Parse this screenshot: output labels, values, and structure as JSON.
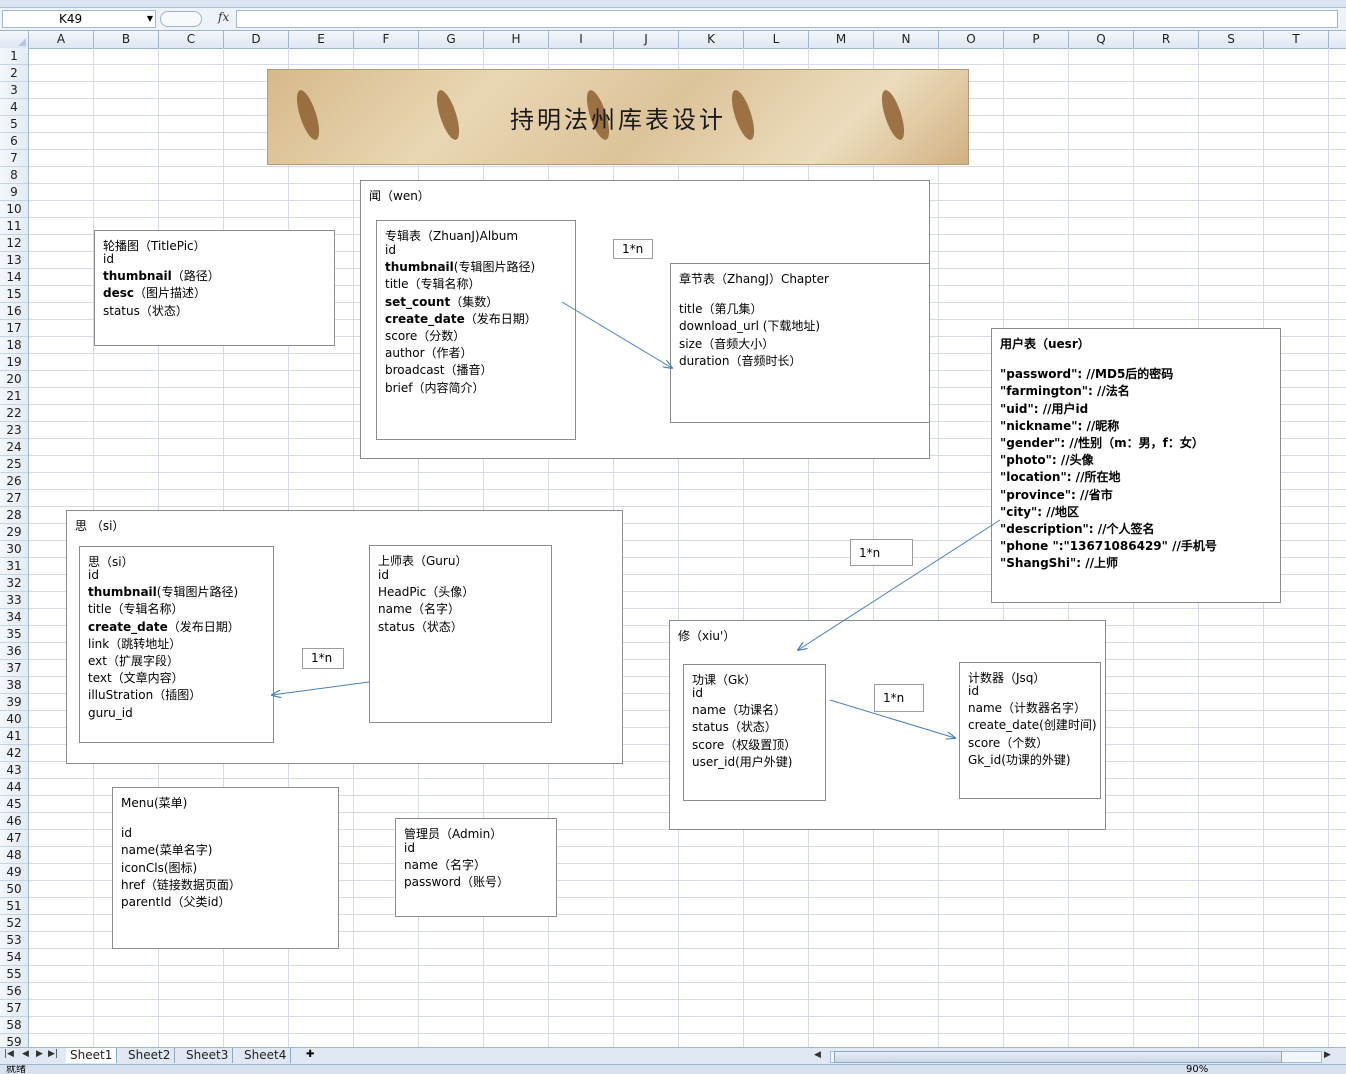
{
  "formula_bar": {
    "name_box": "K49",
    "fx_label": "fx",
    "formula": ""
  },
  "columns": [
    "A",
    "B",
    "C",
    "D",
    "E",
    "F",
    "G",
    "H",
    "I",
    "J",
    "K",
    "L",
    "M",
    "N",
    "O",
    "P",
    "Q",
    "R",
    "S",
    "T"
  ],
  "rows": [
    "1",
    "2",
    "3",
    "4",
    "5",
    "6",
    "7",
    "8",
    "9",
    "10",
    "11",
    "12",
    "13",
    "14",
    "15",
    "16",
    "17",
    "18",
    "19",
    "20",
    "21",
    "22",
    "23",
    "24",
    "25",
    "26",
    "27",
    "28",
    "29",
    "30",
    "31",
    "32",
    "33",
    "34",
    "35",
    "36",
    "37",
    "38",
    "39",
    "40",
    "41",
    "42",
    "43",
    "44",
    "45",
    "46",
    "47",
    "48",
    "49",
    "50",
    "51",
    "52",
    "53",
    "54",
    "55",
    "56",
    "57",
    "58",
    "59"
  ],
  "banner": {
    "title": "持明法州库表设计"
  },
  "groups": {
    "wen": "闻（wen）",
    "si": "思 （si）",
    "xiu": "修（xiu'）"
  },
  "tables": {
    "titlepic": {
      "title": "轮播图（TitlePic）",
      "fields": [
        {
          "text": "id",
          "bold": false
        },
        {
          "text": "thumbnail",
          "bold": true,
          "rest": "（路径）"
        },
        {
          "text": "desc",
          "bold": true,
          "rest": "（图片描述）"
        },
        {
          "text": "status（状态）",
          "bold": false
        }
      ]
    },
    "album": {
      "title": "专辑表（ZhuanJ)Album",
      "fields": [
        {
          "text": "id",
          "bold": false
        },
        {
          "text": "thumbnail",
          "bold": true,
          "rest": "(专辑图片路径)"
        },
        {
          "text": "title（专辑名称）",
          "bold": false
        },
        {
          "text": "set_count",
          "bold": true,
          "rest": "（集数）"
        },
        {
          "text": "create_date",
          "bold": true,
          "rest": "（发布日期）"
        },
        {
          "text": "score（分数）",
          "bold": false
        },
        {
          "text": "author（作者）",
          "bold": false
        },
        {
          "text": "broadcast（播音）",
          "bold": false
        },
        {
          "text": "brief（内容简介）",
          "bold": false
        }
      ]
    },
    "chapter": {
      "title": "章节表（ZhangJ）Chapter",
      "fields": [
        {
          "text": "",
          "bold": false
        },
        {
          "text": "title（第几集）",
          "bold": false
        },
        {
          "text": "download_url (下载地址)",
          "bold": false
        },
        {
          "text": "size（音频大小）",
          "bold": false
        },
        {
          "text": "duration（音频时长）",
          "bold": false
        }
      ]
    },
    "user": {
      "title": "用户表（uesr）",
      "fields": [
        {
          "text": "",
          "bold": true
        },
        {
          "text": "\"password\":    //MD5后的密码",
          "bold": true
        },
        {
          "text": "\"farmington\":  //法名",
          "bold": true
        },
        {
          "text": "\"uid\": //用户id",
          "bold": true
        },
        {
          "text": " \"nickname\":  //昵称",
          "bold": true
        },
        {
          "text": " \"gender\": //性别（m：男，f：女）",
          "bold": true
        },
        {
          "text": "  \"photo\":  //头像",
          "bold": true
        },
        {
          "text": "\"location\":  //所在地",
          "bold": true
        },
        {
          "text": "\"province\":  //省市",
          "bold": true
        },
        {
          "text": "\"city\":   //地区",
          "bold": true
        },
        {
          "text": " \"description\":  //个人签名",
          "bold": true
        },
        {
          "text": " \"phone \":\"13671086429\"     //手机号",
          "bold": true
        },
        {
          "text": "\"ShangShi\": //上师",
          "bold": true
        }
      ]
    },
    "si": {
      "title": "思（si）",
      "fields": [
        {
          "text": "id",
          "bold": false
        },
        {
          "text": "thumbnail",
          "bold": true,
          "rest": "(专辑图片路径)"
        },
        {
          "text": "title（专辑名称）",
          "bold": false
        },
        {
          "text": "create_date",
          "bold": true,
          "rest": "（发布日期）"
        },
        {
          "text": "link（跳转地址）",
          "bold": false
        },
        {
          "text": "ext（扩展字段）",
          "bold": false
        },
        {
          "text": "text（文章内容）",
          "bold": false
        },
        {
          "text": "illuStration（插图）",
          "bold": false
        },
        {
          "text": "guru_id",
          "bold": false
        }
      ]
    },
    "guru": {
      "title": "上师表（Guru）",
      "fields": [
        {
          "text": "id",
          "bold": false
        },
        {
          "text": "HeadPic（头像）",
          "bold": false
        },
        {
          "text": "name（名字）",
          "bold": false
        },
        {
          "text": "status（状态）",
          "bold": false
        }
      ]
    },
    "gk": {
      "title": "功课（Gk）",
      "fields": [
        {
          "text": "id",
          "bold": false
        },
        {
          "text": "name（功课名）",
          "bold": false
        },
        {
          "text": "status（状态）",
          "bold": false
        },
        {
          "text": "score（权级置顶）",
          "bold": false
        },
        {
          "text": "user_id(用户外键)",
          "bold": false
        }
      ]
    },
    "jsq": {
      "title": "计数器（Jsq）",
      "fields": [
        {
          "text": "id",
          "bold": false
        },
        {
          "text": "name（计数器名字）",
          "bold": false
        },
        {
          "text": "create_date(创建时间)",
          "bold": false
        },
        {
          "text": "score（个数）",
          "bold": false
        },
        {
          "text": "Gk_id(功课的外键)",
          "bold": false
        }
      ]
    },
    "menu": {
      "title": "Menu(菜单)",
      "fields": [
        {
          "text": "",
          "bold": false
        },
        {
          "text": "id",
          "bold": false
        },
        {
          "text": "name(菜单名字)",
          "bold": false
        },
        {
          "text": "iconCls(图标)",
          "bold": false
        },
        {
          "text": "href（链接数据页面）",
          "bold": false
        },
        {
          "text": "parentId（父类id）",
          "bold": false
        }
      ]
    },
    "admin": {
      "title": "管理员（Admin）",
      "fields": [
        {
          "text": "id",
          "bold": false
        },
        {
          "text": "name（名字）",
          "bold": false
        },
        {
          "text": "password（账号）",
          "bold": false
        }
      ]
    }
  },
  "relations": {
    "album_chapter": "1*n",
    "user_gk": "1*n",
    "guru_si": "1*n",
    "gk_jsq": "1*n"
  },
  "sheet_tabs": [
    "Sheet1",
    "Sheet2",
    "Sheet3",
    "Sheet4"
  ],
  "status_bar": {
    "ready": "就绪",
    "zoom": "90%"
  },
  "colors": {
    "arrow": "#4a7ebb",
    "grid": "#d4dbe6",
    "header": "#dde7f3"
  }
}
